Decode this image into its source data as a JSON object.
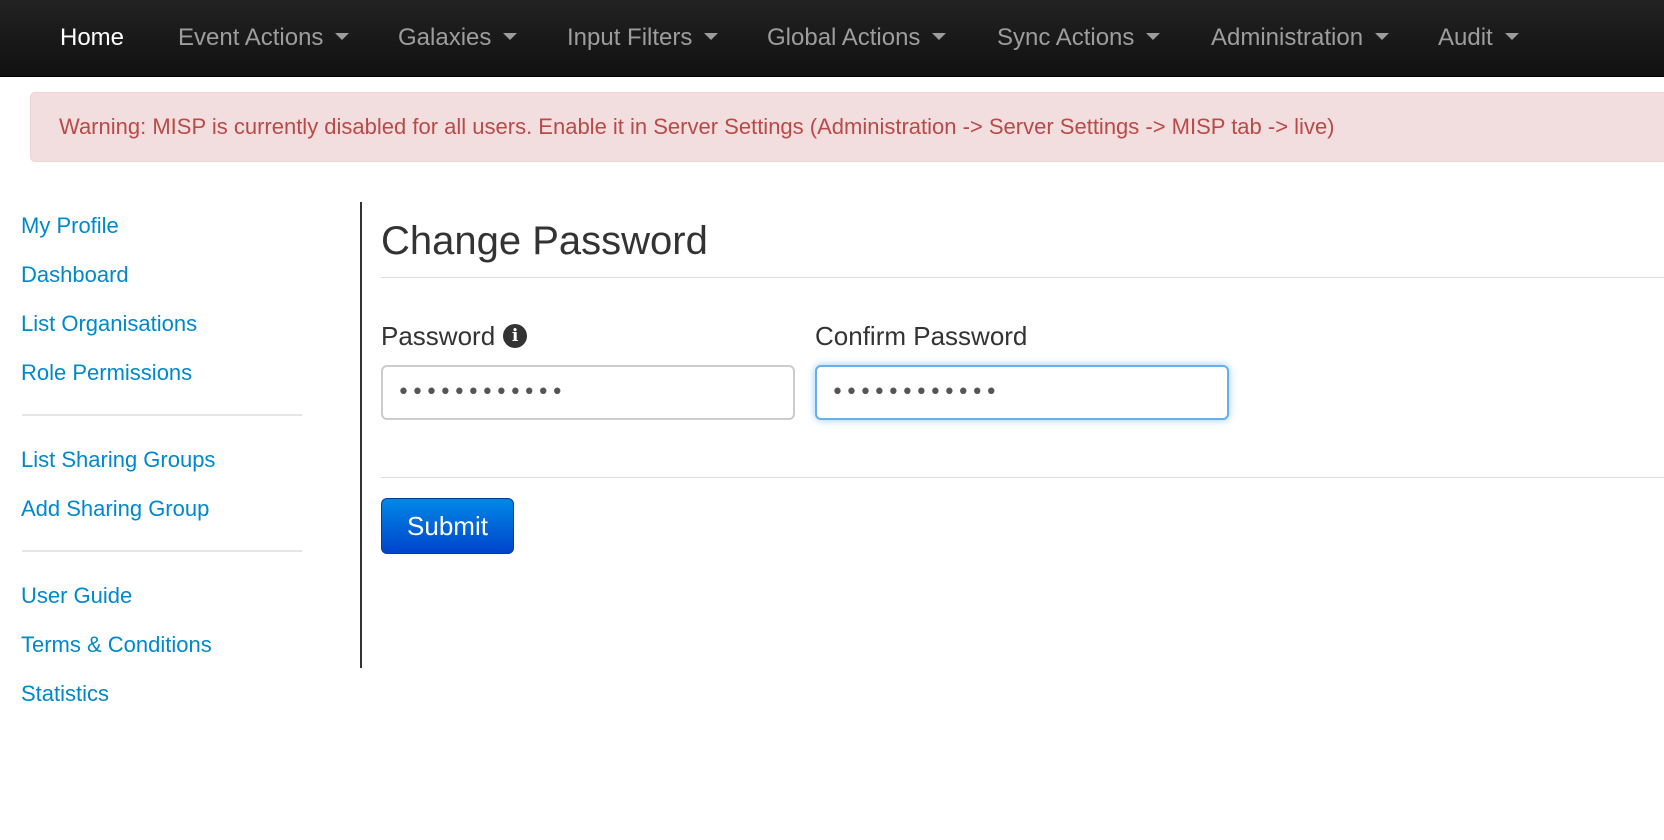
{
  "navbar": {
    "items": [
      {
        "label": "Home",
        "active": true,
        "dropdown": false
      },
      {
        "label": "Event Actions",
        "dropdown": true
      },
      {
        "label": "Galaxies",
        "dropdown": true
      },
      {
        "label": "Input Filters",
        "dropdown": true
      },
      {
        "label": "Global Actions",
        "dropdown": true
      },
      {
        "label": "Sync Actions",
        "dropdown": true
      },
      {
        "label": "Administration",
        "dropdown": true
      },
      {
        "label": "Audit",
        "dropdown": true
      }
    ]
  },
  "alert": {
    "text": "Warning: MISP is currently disabled for all users. Enable it in Server Settings (Administration -> Server Settings -> MISP tab -> live)"
  },
  "sidebar": {
    "groups": [
      [
        "My Profile",
        "Dashboard",
        "List Organisations",
        "Role Permissions"
      ],
      [
        "List Sharing Groups",
        "Add Sharing Group"
      ],
      [
        "User Guide",
        "Terms & Conditions",
        "Statistics"
      ]
    ]
  },
  "form": {
    "title": "Change Password",
    "password_label": "Password",
    "password_value": "••••••••••••",
    "confirm_label": "Confirm Password",
    "confirm_value": "••••••••••••",
    "submit_label": "Submit"
  },
  "colors": {
    "navbar_bg": "#1b1b1b",
    "alert_bg": "#f2dede",
    "alert_text": "#b94a48",
    "link": "#0088cc",
    "submit_bg": "#0055cc"
  },
  "icons": {
    "password_info": "info-icon",
    "dropdown": "caret-down-icon"
  }
}
